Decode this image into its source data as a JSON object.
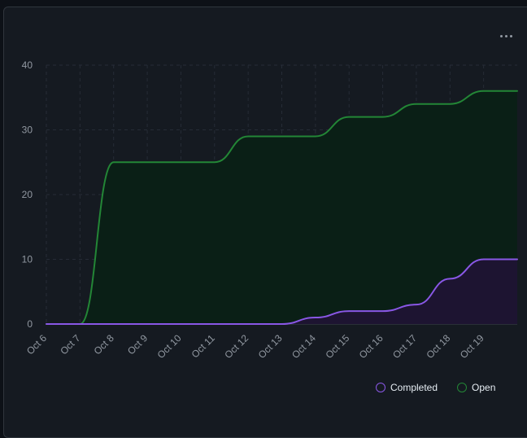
{
  "menu": {
    "more_icon": "kebab-horizontal-icon"
  },
  "chart_data": {
    "type": "area",
    "x": [
      "Oct 6",
      "Oct 7",
      "Oct 8",
      "Oct 9",
      "Oct 10",
      "Oct 11",
      "Oct 12",
      "Oct 13",
      "Oct 14",
      "Oct 15",
      "Oct 16",
      "Oct 17",
      "Oct 18",
      "Oct 19"
    ],
    "x_range": [
      "Oct 6",
      "Oct 20"
    ],
    "ylim": [
      0,
      40
    ],
    "y_ticks": [
      0,
      10,
      20,
      30,
      40
    ],
    "grid": true,
    "legend_position": "bottom-right",
    "series": [
      {
        "name": "Open",
        "color": "#238636",
        "fill": "#0a1f16",
        "points": [
          [
            "Oct 6",
            0
          ],
          [
            "Oct 7",
            0
          ],
          [
            "Oct 8",
            25
          ],
          [
            "Oct 9",
            25
          ],
          [
            "Oct 10",
            25
          ],
          [
            "Oct 11",
            25
          ],
          [
            "Oct 12",
            29
          ],
          [
            "Oct 13",
            29
          ],
          [
            "Oct 14",
            29
          ],
          [
            "Oct 15",
            32
          ],
          [
            "Oct 16",
            32
          ],
          [
            "Oct 17",
            34
          ],
          [
            "Oct 18",
            34
          ],
          [
            "Oct 19",
            36
          ],
          [
            "Oct 20",
            36
          ]
        ]
      },
      {
        "name": "Completed",
        "color": "#8957e5",
        "fill": "#1d1431",
        "points": [
          [
            "Oct 6",
            0
          ],
          [
            "Oct 7",
            0
          ],
          [
            "Oct 8",
            0
          ],
          [
            "Oct 9",
            0
          ],
          [
            "Oct 10",
            0
          ],
          [
            "Oct 11",
            0
          ],
          [
            "Oct 12",
            0
          ],
          [
            "Oct 13",
            0
          ],
          [
            "Oct 14",
            1
          ],
          [
            "Oct 15",
            2
          ],
          [
            "Oct 16",
            2
          ],
          [
            "Oct 17",
            3
          ],
          [
            "Oct 18",
            7
          ],
          [
            "Oct 19",
            10
          ],
          [
            "Oct 20",
            10
          ]
        ]
      }
    ]
  },
  "legend": [
    {
      "label": "Completed",
      "color": "#8957e5"
    },
    {
      "label": "Open",
      "color": "#238636"
    }
  ]
}
